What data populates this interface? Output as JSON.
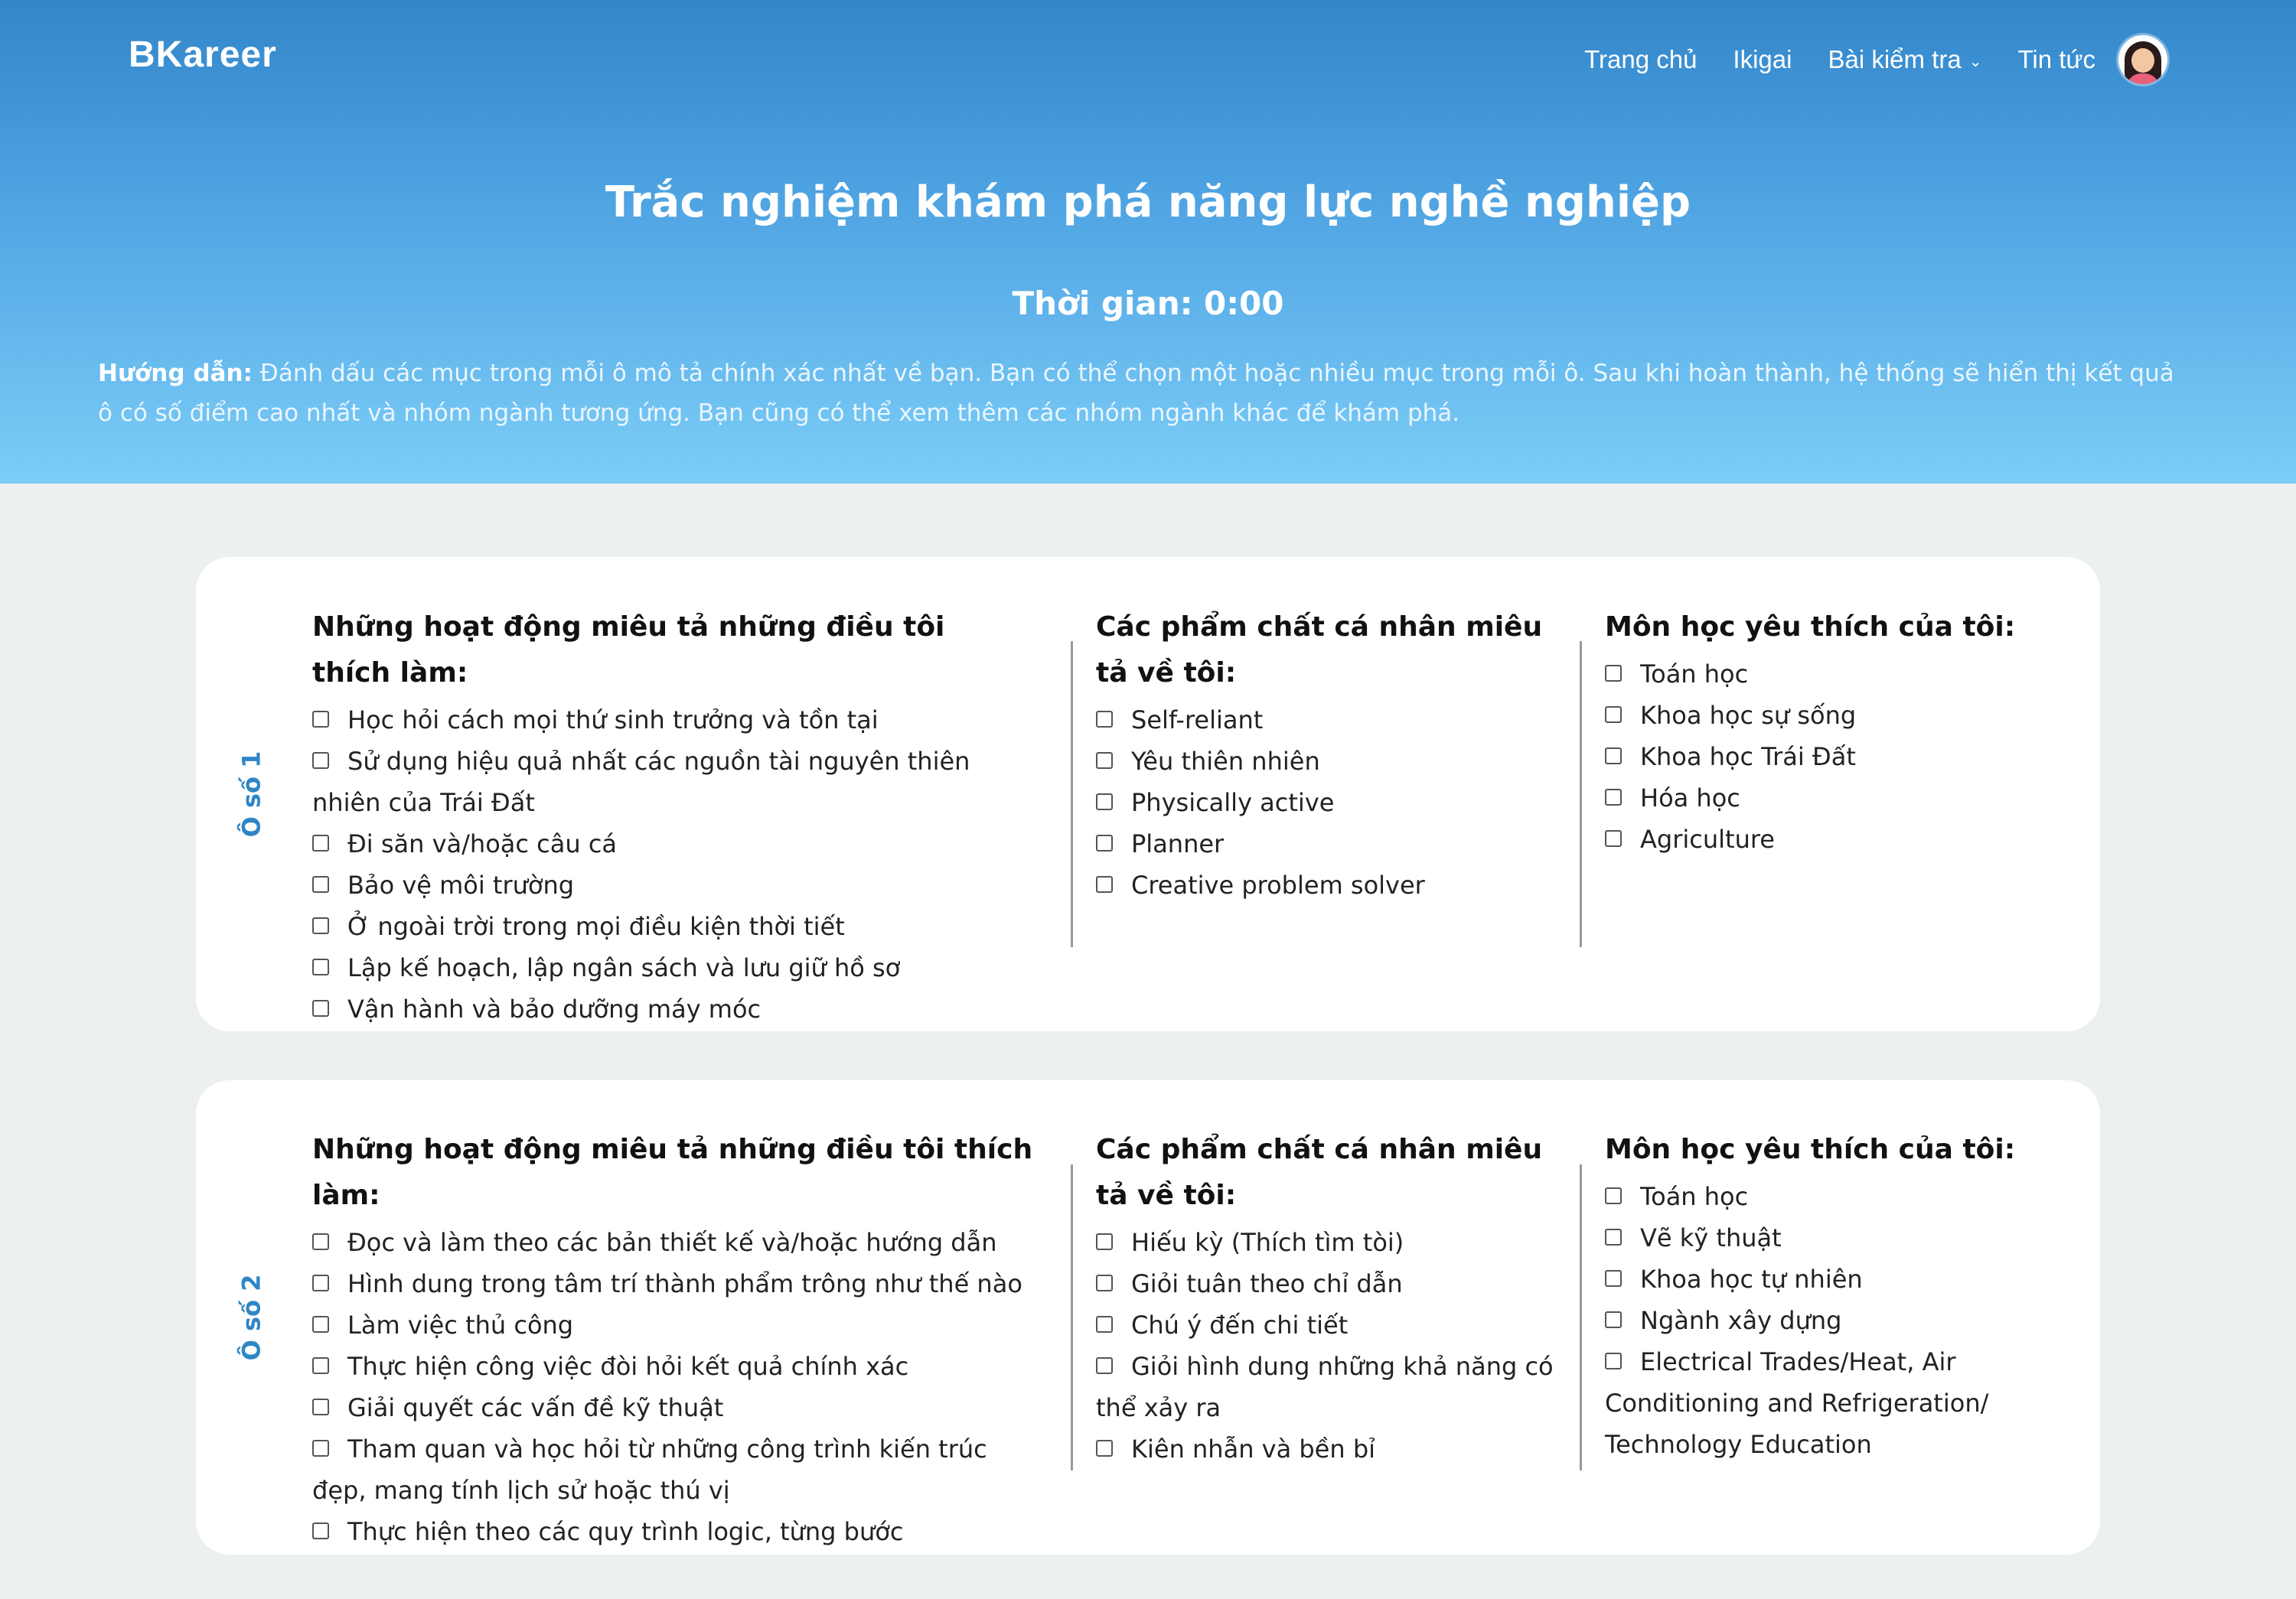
{
  "brand": "BKareer",
  "nav": {
    "items": [
      "Trang chủ",
      "Ikigai",
      "Bài kiểm tra",
      "Tin tức"
    ],
    "dropdown_icon": "chevron-down"
  },
  "hero": {
    "title": "Trắc nghiệm khám phá năng lực nghề nghiệp",
    "timer": "Thời gian: 0:00",
    "guide_label": "Hướng dẫn:",
    "guide_text": " Đánh dấu các mục trong mỗi ô mô tả chính xác nhất về bạn. Bạn có thể chọn một hoặc nhiều mục trong mỗi ô. Sau khi hoàn thành, hệ thống sẽ hiển thị kết quả ô có số điểm cao nhất và nhóm ngành tương ứng. Bạn cũng có thể xem thêm các nhóm ngành khác để khám phá."
  },
  "boxes": [
    {
      "label": "Ô số 1",
      "activities_title": "Những hoạt động miêu tả những điều tôi thích làm:",
      "activities": [
        "Học hỏi cách mọi thứ sinh trưởng và tồn tại",
        "Sử dụng hiệu quả nhất các nguồn tài nguyên thiên nhiên của Trái Đất",
        "Đi săn và/hoặc câu cá",
        "Bảo vệ môi trường",
        "Ở ngoài trời trong mọi điều kiện thời tiết",
        "Lập kế hoạch, lập ngân sách và lưu giữ hồ sơ",
        "Vận hành và bảo dưỡng máy móc"
      ],
      "qualities_title": "Các phẩm chất cá nhân miêu tả về tôi:",
      "qualities": [
        "Self-reliant",
        "Yêu thiên nhiên",
        "Physically active",
        "Planner",
        "Creative problem solver"
      ],
      "subjects_title": "Môn học yêu thích của tôi:",
      "subjects": [
        "Toán học",
        "Khoa học sự sống",
        "Khoa học Trái Đất",
        "Hóa học",
        "Agriculture"
      ]
    },
    {
      "label": "Ô số 2",
      "activities_title": "Những hoạt động miêu tả những điều tôi thích làm:",
      "activities": [
        "Đọc và làm theo các bản thiết kế và/hoặc hướng dẫn",
        "Hình dung trong tâm trí thành phẩm trông như thế nào",
        "Làm việc thủ công",
        "Thực hiện công việc đòi hỏi kết quả chính xác",
        "Giải quyết các vấn đề kỹ thuật",
        "Tham quan và học hỏi từ những công trình kiến trúc đẹp, mang tính lịch sử hoặc thú vị",
        "Thực hiện theo các quy trình logic, từng bước"
      ],
      "qualities_title": "Các phẩm chất cá nhân miêu tả về tôi:",
      "qualities": [
        "Hiếu kỳ (Thích tìm tòi)",
        "Giỏi tuân theo chỉ dẫn",
        "Chú ý đến chi tiết",
        "Giỏi hình dung những khả năng có thể xảy ra",
        "Kiên nhẫn và bền bỉ"
      ],
      "subjects_title": "Môn học yêu thích của tôi:",
      "subjects": [
        "Toán học",
        "Vẽ kỹ thuật",
        "Khoa học tự nhiên",
        "Ngành xây dựng",
        "Electrical Trades/Heat, Air Conditioning and Refrigeration/ Technology Education"
      ]
    }
  ]
}
